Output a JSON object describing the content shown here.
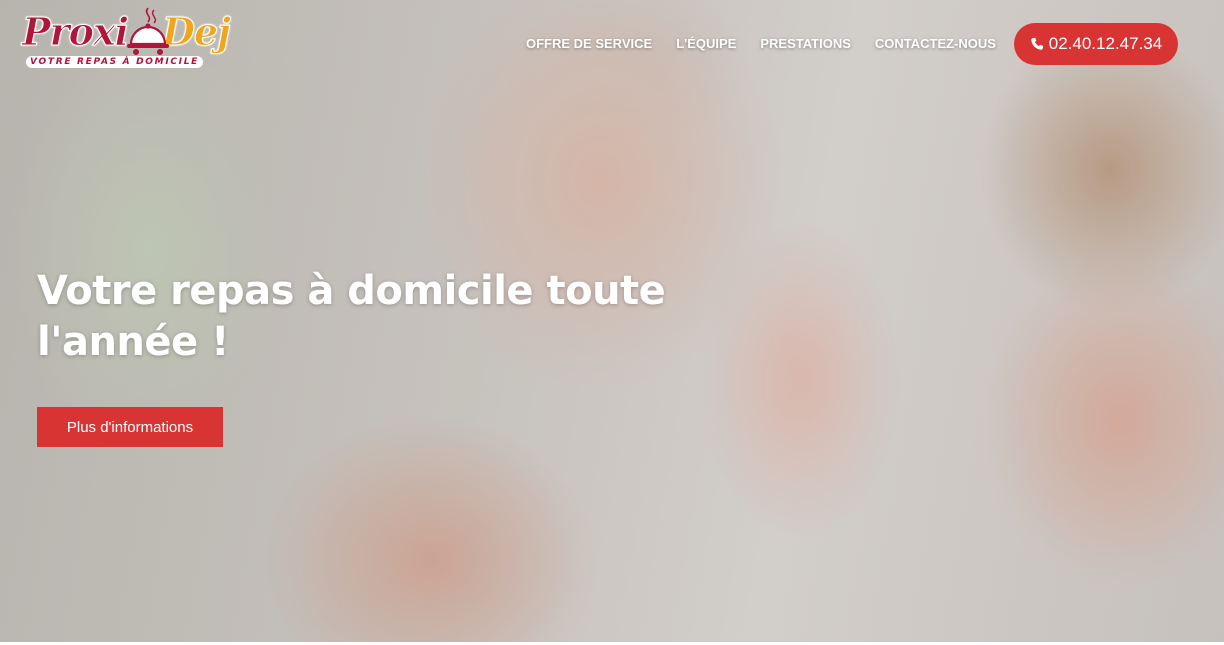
{
  "brand": {
    "name_part1": "Proxi",
    "name_part2": "Dej",
    "tagline": "VOTRE REPAS À DOMICILE",
    "colors": {
      "primary": "#b0153a",
      "secondary": "#f0a61a",
      "accent": "#d93434"
    }
  },
  "nav": {
    "items": [
      {
        "label": "OFFRE DE SERVICE"
      },
      {
        "label": "L'ÉQUIPE"
      },
      {
        "label": "PRESTATIONS"
      },
      {
        "label": "CONTACTEZ-NOUS"
      }
    ]
  },
  "phone": {
    "icon": "phone-icon",
    "number": "02.40.12.47.34"
  },
  "hero": {
    "title": "Votre repas à domicile toute l'année !",
    "cta_label": "Plus d'informations",
    "background": "photo-of-smiling-seniors"
  }
}
